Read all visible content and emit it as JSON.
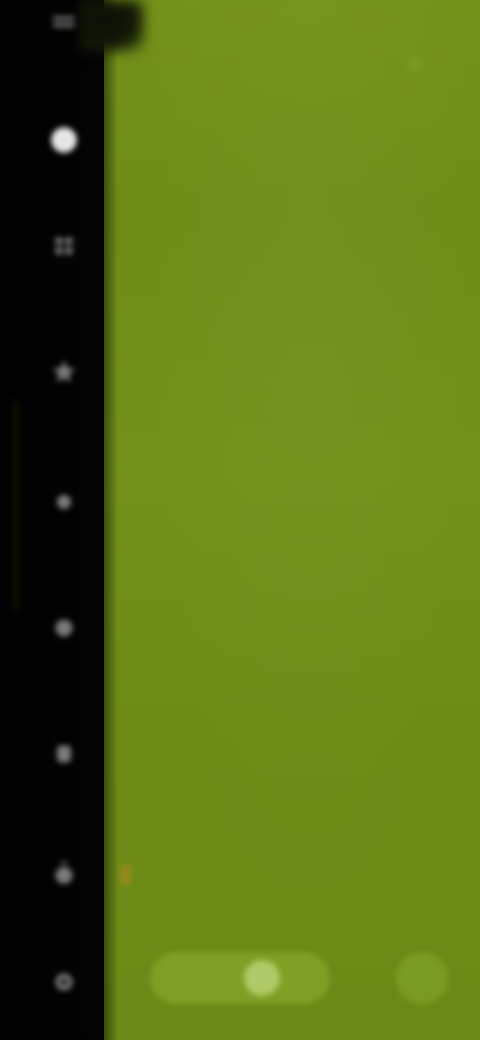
{
  "viewer": {
    "background_color": "#72901a",
    "caption_text": ""
  },
  "sidebar": {
    "items": [
      {
        "name": "menu",
        "icon": "menu-icon",
        "active": false
      },
      {
        "name": "capture",
        "icon": "circle-icon",
        "active": true
      },
      {
        "name": "tool-1",
        "icon": "grid-icon",
        "active": false
      },
      {
        "name": "tool-2",
        "icon": "star-icon",
        "active": false
      },
      {
        "name": "tool-3",
        "icon": "sun-icon",
        "active": false
      },
      {
        "name": "tool-4",
        "icon": "palette-icon",
        "active": false
      },
      {
        "name": "tool-5",
        "icon": "brush-icon",
        "active": false
      },
      {
        "name": "tool-6",
        "icon": "timer-icon",
        "active": false
      },
      {
        "name": "tool-7",
        "icon": "gear-icon",
        "active": false
      }
    ]
  },
  "controls": {
    "shutter": "shutter-toggle",
    "secondary": "switch-icon"
  },
  "colors": {
    "rail": "#000000",
    "accent_dark": "#1a2409",
    "viewer_green": "#72901a",
    "highlight_yellow": "#a08a1c"
  }
}
